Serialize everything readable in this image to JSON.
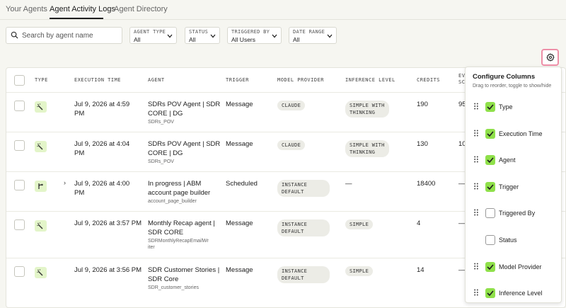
{
  "tabs": [
    {
      "label": "Your Agents",
      "active": false
    },
    {
      "label": "Agent Activity Logs",
      "active": true
    },
    {
      "label": "Agent Directory",
      "active": false
    }
  ],
  "search": {
    "placeholder": "Search by agent name"
  },
  "filters": [
    {
      "label": "AGENT TYPE",
      "value": "All"
    },
    {
      "label": "STATUS",
      "value": "All"
    },
    {
      "label": "TRIGGERED BY",
      "value": "All Users"
    },
    {
      "label": "DATE RANGE",
      "value": "All"
    }
  ],
  "columns": [
    "TYPE",
    "EXECUTION TIME",
    "AGENT",
    "TRIGGER",
    "MODEL PROVIDER",
    "INFERENCE LEVEL",
    "CREDITS",
    "EV",
    "SC"
  ],
  "rows": [
    {
      "icon": "wand-icon",
      "time_line1": "Jul 9, 2026 at 4:59",
      "time_line2": "PM",
      "agent_line1": "SDRs POV Agent | SDR",
      "agent_line2": "CORE | DG",
      "agent_sub1": "SDRs_POV",
      "agent_sub2": "",
      "trigger": "Message",
      "model_line1": "CLAUDE",
      "model_line2": "",
      "inference_line1": "SIMPLE WITH",
      "inference_line2": "THINKING",
      "credits": "190",
      "extra": "95"
    },
    {
      "icon": "wand-icon",
      "time_line1": "Jul 9, 2026 at 4:04",
      "time_line2": "PM",
      "agent_line1": "SDRs POV Agent | SDR",
      "agent_line2": "CORE | DG",
      "agent_sub1": "SDRs_POV",
      "agent_sub2": "",
      "trigger": "Message",
      "model_line1": "CLAUDE",
      "model_line2": "",
      "inference_line1": "SIMPLE WITH",
      "inference_line2": "THINKING",
      "credits": "130",
      "extra": "10"
    },
    {
      "icon": "workflow-icon",
      "expand": "›",
      "time_line1": "Jul 9, 2026 at 4:00",
      "time_line2": "PM",
      "agent_line1": "In progress | ABM",
      "agent_line2": "account page builder",
      "agent_sub1": "account_page_builder",
      "agent_sub2": "",
      "trigger": "Scheduled",
      "model_line1": "INSTANCE",
      "model_line2": "DEFAULT",
      "inference_line1": "—",
      "inference_line2": "",
      "credits": "18400",
      "extra": "—"
    },
    {
      "icon": "wand-icon",
      "time_line1": "Jul 9, 2026 at 3:57 PM",
      "time_line2": "",
      "agent_line1": "Monthly Recap agent |",
      "agent_line2": "SDR CORE",
      "agent_sub1": "SDRMonthlyRecapEmailWr",
      "agent_sub2": "iter",
      "trigger": "Message",
      "model_line1": "INSTANCE",
      "model_line2": "DEFAULT",
      "inference_line1": "SIMPLE",
      "inference_line2": "",
      "credits": "4",
      "extra": "—"
    },
    {
      "icon": "wand-icon",
      "time_line1": "Jul 9, 2026 at 3:56 PM",
      "time_line2": "",
      "agent_line1": "SDR Customer Stories |",
      "agent_line2": "SDR Core",
      "agent_sub1": "SDR_customer_stories",
      "agent_sub2": "",
      "trigger": "Message",
      "model_line1": "INSTANCE",
      "model_line2": "DEFAULT",
      "inference_line1": "SIMPLE",
      "inference_line2": "",
      "credits": "14",
      "extra": "—"
    }
  ],
  "config_panel": {
    "title": "Configure Columns",
    "subtitle": "Drag to reorder, toggle to show/hide",
    "items": [
      {
        "label": "Type",
        "checked": true
      },
      {
        "label": "Execution Time",
        "checked": true
      },
      {
        "label": "Agent",
        "checked": true
      },
      {
        "label": "Trigger",
        "checked": true
      },
      {
        "label": "Triggered By",
        "checked": false
      },
      {
        "label": "Status",
        "checked": false
      },
      {
        "label": "Model Provider",
        "checked": true
      },
      {
        "label": "Inference Level",
        "checked": true
      }
    ]
  },
  "colors": {
    "accent_green": "#8fe04a",
    "type_badge_bg": "#e3f5c9",
    "highlight_border": "#ee8fa8",
    "page_bg": "#f6f6f1"
  }
}
